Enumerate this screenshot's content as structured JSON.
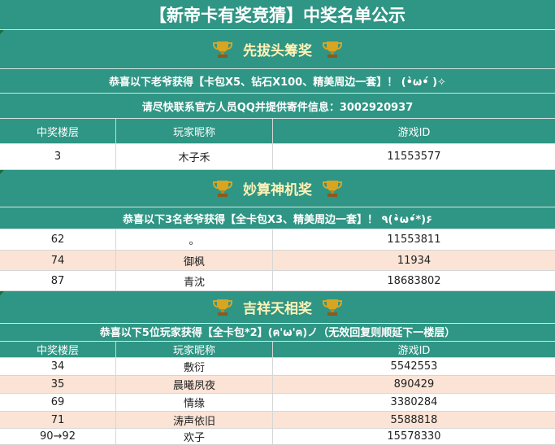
{
  "title": "【新帝卡有奖竞猜】中奖名单公示",
  "sections": [
    {
      "name": "先拔头筹奖",
      "lines": [
        "恭喜以下老爷获得【卡包X5、钻石X100、精美周边一套】！ (•̀ω•́ )✧",
        "请尽快联系官方人员QQ并提供寄件信息：3002920937"
      ],
      "headers": [
        "中奖楼层",
        "玩家昵称",
        "游戏ID"
      ],
      "rows": [
        [
          "3",
          "木子禾",
          "11553577"
        ]
      ]
    },
    {
      "name": "妙算神机奖",
      "lines": [
        "恭喜以下3名老爷获得【全卡包X3、精美周边一套】！ ٩(•̀ω•́*)۶"
      ],
      "rows": [
        [
          "62",
          "。",
          "11553811"
        ],
        [
          "74",
          "御枫",
          "11934"
        ],
        [
          "87",
          "青沈",
          "18683802"
        ]
      ]
    },
    {
      "name": "吉祥天相奖",
      "lines": [
        "恭喜以下5位玩家获得【全卡包*2】(ฅ'ω'ฅ)ノ（无效回复则顺延下一楼层）"
      ],
      "headers": [
        "中奖楼层",
        "玩家昵称",
        "游戏ID"
      ],
      "rows": [
        [
          "34",
          "敷衍",
          "5542553"
        ],
        [
          "35",
          "晨曦夙夜",
          "890429"
        ],
        [
          "69",
          "情缘",
          "3380284"
        ],
        [
          "71",
          "涛声依旧",
          "5588818"
        ],
        [
          "90→92",
          "欢子",
          "15578330"
        ]
      ]
    }
  ],
  "colors": {
    "teal": "#2f9584",
    "peach": "#fbe4d6",
    "gold": "#fff2b6"
  },
  "icons": {
    "trophy": "trophy-icon"
  }
}
